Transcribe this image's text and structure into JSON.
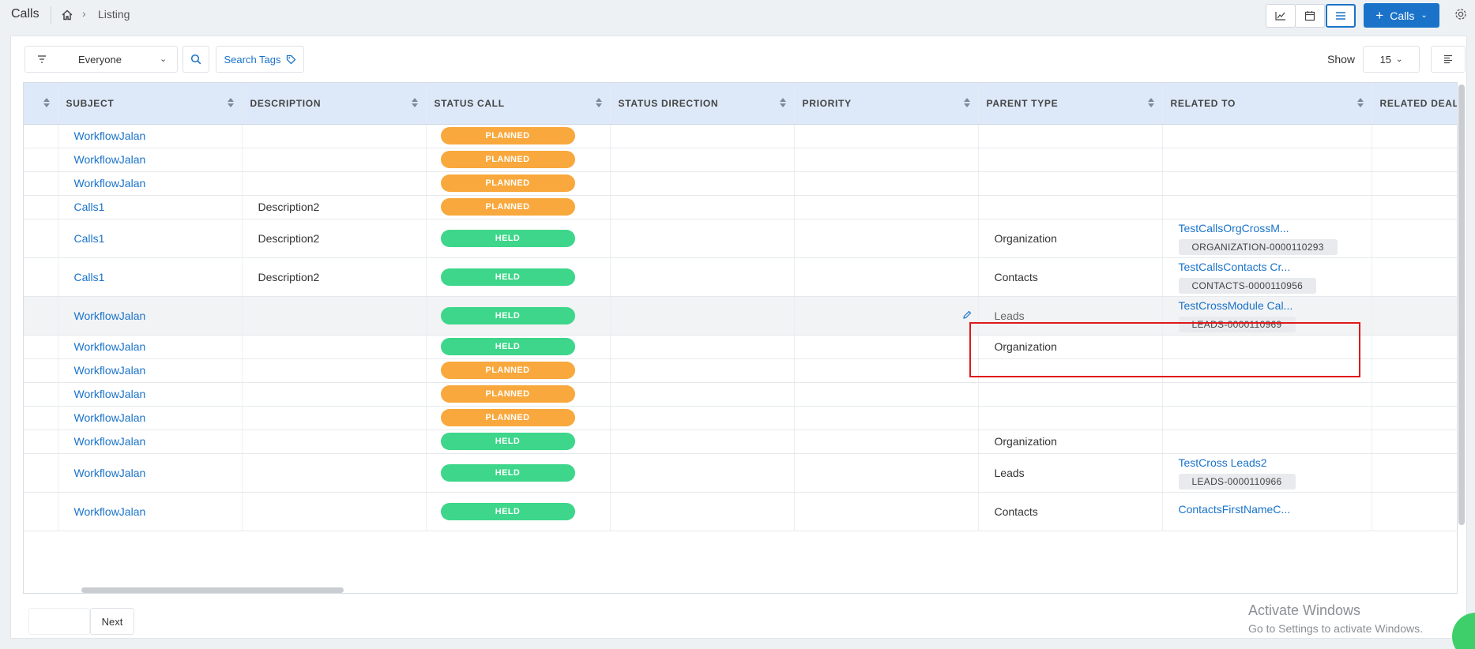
{
  "header": {
    "title": "Calls",
    "breadcrumb_current": "Listing",
    "add_button_label": "Calls"
  },
  "toolbar": {
    "filter_value": "Everyone",
    "search_tags_label": "Search Tags",
    "show_label": "Show",
    "show_value": "15"
  },
  "table": {
    "columns": [
      "SUBJECT",
      "DESCRIPTION",
      "STATUS CALL",
      "STATUS DIRECTION",
      "PRIORITY",
      "PARENT TYPE",
      "RELATED TO",
      "RELATED DEAL"
    ],
    "rows": [
      {
        "subject": "WorkflowJalan",
        "description": "",
        "status": "PLANNED",
        "parent_type": "",
        "related_name": "",
        "related_id": ""
      },
      {
        "subject": "WorkflowJalan",
        "description": "",
        "status": "PLANNED",
        "parent_type": "",
        "related_name": "",
        "related_id": ""
      },
      {
        "subject": "WorkflowJalan",
        "description": "",
        "status": "PLANNED",
        "parent_type": "",
        "related_name": "",
        "related_id": ""
      },
      {
        "subject": "Calls1",
        "description": "Description2",
        "status": "PLANNED",
        "parent_type": "",
        "related_name": "",
        "related_id": ""
      },
      {
        "subject": "Calls1",
        "description": "Description2",
        "status": "HELD",
        "parent_type": "Organization",
        "related_name": "TestCallsOrgCrossM...",
        "related_id": "ORGANIZATION-0000110293"
      },
      {
        "subject": "Calls1",
        "description": "Description2",
        "status": "HELD",
        "parent_type": "Contacts",
        "related_name": "TestCallsContacts Cr...",
        "related_id": "CONTACTS-0000110956"
      },
      {
        "subject": "WorkflowJalan",
        "description": "",
        "status": "HELD",
        "parent_type": "Leads",
        "related_name": "TestCrossModule Cal...",
        "related_id": "LEADS-0000110969"
      },
      {
        "subject": "WorkflowJalan",
        "description": "",
        "status": "HELD",
        "parent_type": "Organization",
        "related_name": "",
        "related_id": ""
      },
      {
        "subject": "WorkflowJalan",
        "description": "",
        "status": "PLANNED",
        "parent_type": "",
        "related_name": "",
        "related_id": ""
      },
      {
        "subject": "WorkflowJalan",
        "description": "",
        "status": "PLANNED",
        "parent_type": "",
        "related_name": "",
        "related_id": ""
      },
      {
        "subject": "WorkflowJalan",
        "description": "",
        "status": "PLANNED",
        "parent_type": "",
        "related_name": "",
        "related_id": ""
      },
      {
        "subject": "WorkflowJalan",
        "description": "",
        "status": "HELD",
        "parent_type": "Organization",
        "related_name": "",
        "related_id": ""
      },
      {
        "subject": "WorkflowJalan",
        "description": "",
        "status": "HELD",
        "parent_type": "Leads",
        "related_name": "TestCross Leads2",
        "related_id": "LEADS-0000110966"
      },
      {
        "subject": "WorkflowJalan",
        "description": "",
        "status": "HELD",
        "parent_type": "Contacts",
        "related_name": "ContactsFirstNameC...",
        "related_id": ""
      }
    ]
  },
  "pagination": {
    "next_label": "Next"
  },
  "watermark": {
    "title": "Activate Windows",
    "subtitle": "Go to Settings to activate Windows."
  },
  "colors": {
    "accent": "#1a73c9",
    "planned": "#f8a83c",
    "held": "#3dd68a",
    "header_bg": "#dde9f9",
    "highlight": "#e0181b"
  },
  "icons": [
    "home-icon",
    "chart-icon",
    "calendar-icon",
    "list-icon",
    "plus-icon",
    "chevron-down-icon",
    "gear-icon",
    "filter-icon",
    "search-icon",
    "tag-icon",
    "columns-icon",
    "sort-icon",
    "pencil-icon"
  ]
}
